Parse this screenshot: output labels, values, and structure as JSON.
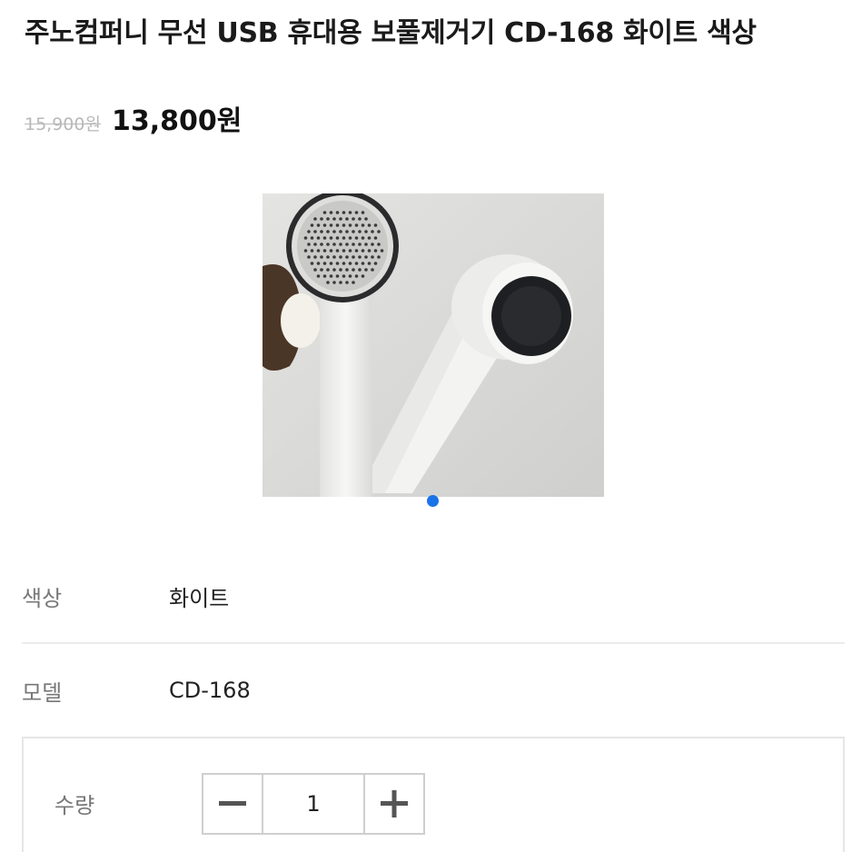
{
  "product": {
    "title": "주노컴퍼니 무선 USB 휴대용 보풀제거기 CD-168 화이트 색상",
    "price_original": "15,900원",
    "price_sale": "13,800원"
  },
  "gallery": {
    "image_count": 1,
    "active_index": 1,
    "indicator_color": "#1a73e8"
  },
  "options": [
    {
      "label": "색상",
      "value": "화이트"
    },
    {
      "label": "모델",
      "value": "CD-168"
    }
  ],
  "quantity": {
    "label": "수량",
    "value": "1",
    "minus_icon": "minus-icon",
    "plus_icon": "plus-icon"
  }
}
